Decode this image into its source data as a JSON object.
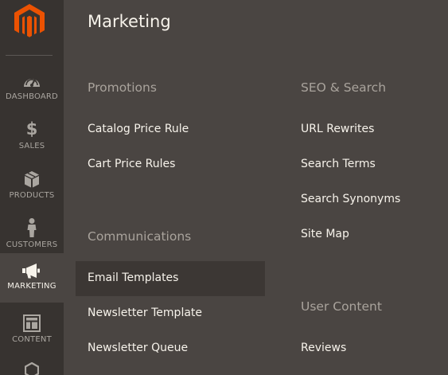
{
  "sidebar": {
    "logo_icon": "magento-logo-icon",
    "brand_color": "#eb5202",
    "items": [
      {
        "label": "DASHBOARD",
        "icon": "gauge-icon"
      },
      {
        "label": "SALES",
        "icon": "dollar-icon",
        "glyph": "$"
      },
      {
        "label": "PRODUCTS",
        "icon": "cube-icon"
      },
      {
        "label": "CUSTOMERS",
        "icon": "person-icon"
      },
      {
        "label": "MARKETING",
        "icon": "megaphone-icon",
        "active": true
      },
      {
        "label": "CONTENT",
        "icon": "layout-icon"
      },
      {
        "label": "",
        "icon": "hexagon-icon"
      }
    ]
  },
  "panel": {
    "title": "Marketing",
    "columns": [
      {
        "sections": [
          {
            "title": "Promotions",
            "links": [
              "Catalog Price Rule",
              "Cart Price Rules"
            ]
          },
          {
            "title": "Communications",
            "links": [
              "Email Templates",
              "Newsletter Template",
              "Newsletter Queue"
            ]
          }
        ]
      },
      {
        "sections": [
          {
            "title": "SEO & Search",
            "links": [
              "URL Rewrites",
              "Search Terms",
              "Search Synonyms",
              "Site Map"
            ]
          },
          {
            "title": "User Content",
            "links": [
              "Reviews"
            ]
          }
        ]
      }
    ],
    "hovered_link": "Email Templates"
  },
  "colors": {
    "sidebar_bg": "#373330",
    "panel_bg": "#4a4542",
    "hover_bg": "#3c3734",
    "text_light": "#f7f3eb",
    "section_title": "#a9a39c"
  }
}
